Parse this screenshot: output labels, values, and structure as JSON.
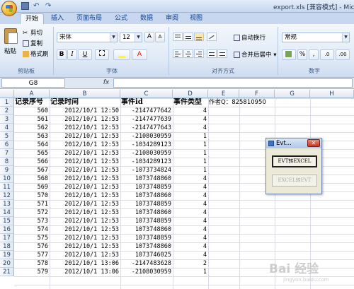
{
  "window": {
    "title": "export.xls [兼容模式] - Micro"
  },
  "tabs": [
    "开始",
    "插入",
    "页面布局",
    "公式",
    "数据",
    "审阅",
    "视图"
  ],
  "ribbon": {
    "paste": "粘贴",
    "cut": "剪切",
    "copy": "复制",
    "format_painter": "格式刷",
    "group_clipboard": "剪贴板",
    "font_name": "宋体",
    "font_size": "12",
    "group_font": "字体",
    "wrap_text": "自动换行",
    "merge_center": "合并后居中",
    "group_alignment": "对齐方式",
    "number_format": "常规",
    "group_number": "数字",
    "percent": "%",
    "comma": ","
  },
  "formula_bar": {
    "name_box": "G8",
    "fx": "fx"
  },
  "columns": [
    "A",
    "B",
    "C",
    "D",
    "E",
    "F",
    "G",
    "H"
  ],
  "header_row": {
    "a": "记录序号",
    "b": "记录时间",
    "c": "事件id",
    "d": "事件类型",
    "e": "作者Q：825810950"
  },
  "rows": [
    {
      "n": "2",
      "a": "560",
      "b": "2012/10/1 12:50",
      "c": "-2147477642",
      "d": "4"
    },
    {
      "n": "3",
      "a": "561",
      "b": "2012/10/1 12:53",
      "c": "-2147477639",
      "d": "4"
    },
    {
      "n": "4",
      "a": "562",
      "b": "2012/10/1 12:53",
      "c": "-2147477643",
      "d": "4"
    },
    {
      "n": "5",
      "a": "563",
      "b": "2012/10/1 12:53",
      "c": "-2108030959",
      "d": "1"
    },
    {
      "n": "6",
      "a": "564",
      "b": "2012/10/1 12:53",
      "c": "-1034289123",
      "d": "1"
    },
    {
      "n": "7",
      "a": "565",
      "b": "2012/10/1 12:53",
      "c": "-2108030959",
      "d": "1"
    },
    {
      "n": "8",
      "a": "566",
      "b": "2012/10/1 12:53",
      "c": "-1034289123",
      "d": "1"
    },
    {
      "n": "9",
      "a": "567",
      "b": "2012/10/1 12:53",
      "c": "-1073734824",
      "d": "1"
    },
    {
      "n": "10",
      "a": "568",
      "b": "2012/10/1 12:53",
      "c": "1073748860",
      "d": "4"
    },
    {
      "n": "11",
      "a": "569",
      "b": "2012/10/1 12:53",
      "c": "1073748859",
      "d": "4"
    },
    {
      "n": "12",
      "a": "570",
      "b": "2012/10/1 12:53",
      "c": "1073748860",
      "d": "4"
    },
    {
      "n": "13",
      "a": "571",
      "b": "2012/10/1 12:53",
      "c": "1073748859",
      "d": "4"
    },
    {
      "n": "14",
      "a": "572",
      "b": "2012/10/1 12:53",
      "c": "1073748860",
      "d": "4"
    },
    {
      "n": "15",
      "a": "573",
      "b": "2012/10/1 12:53",
      "c": "1073748859",
      "d": "4"
    },
    {
      "n": "16",
      "a": "574",
      "b": "2012/10/1 12:53",
      "c": "1073748860",
      "d": "4"
    },
    {
      "n": "17",
      "a": "575",
      "b": "2012/10/1 12:53",
      "c": "1073748859",
      "d": "4"
    },
    {
      "n": "18",
      "a": "576",
      "b": "2012/10/1 12:53",
      "c": "1073748860",
      "d": "4"
    },
    {
      "n": "19",
      "a": "577",
      "b": "2012/10/1 12:53",
      "c": "1073746025",
      "d": "4"
    },
    {
      "n": "20",
      "a": "578",
      "b": "2012/10/1 13:06",
      "c": "-2147483628",
      "d": "2"
    },
    {
      "n": "21",
      "a": "579",
      "b": "2012/10/1 13:06",
      "c": "-2108030959",
      "d": "1"
    }
  ],
  "dialog": {
    "title": "Evt...",
    "close": "✕",
    "btn_evt_to_excel": "EVT转EXCEL",
    "btn_excel_to_evt": "EXCEL转EVT"
  },
  "watermark": {
    "main": "Bai 经验",
    "sub": "jingyan.baidu.com"
  }
}
